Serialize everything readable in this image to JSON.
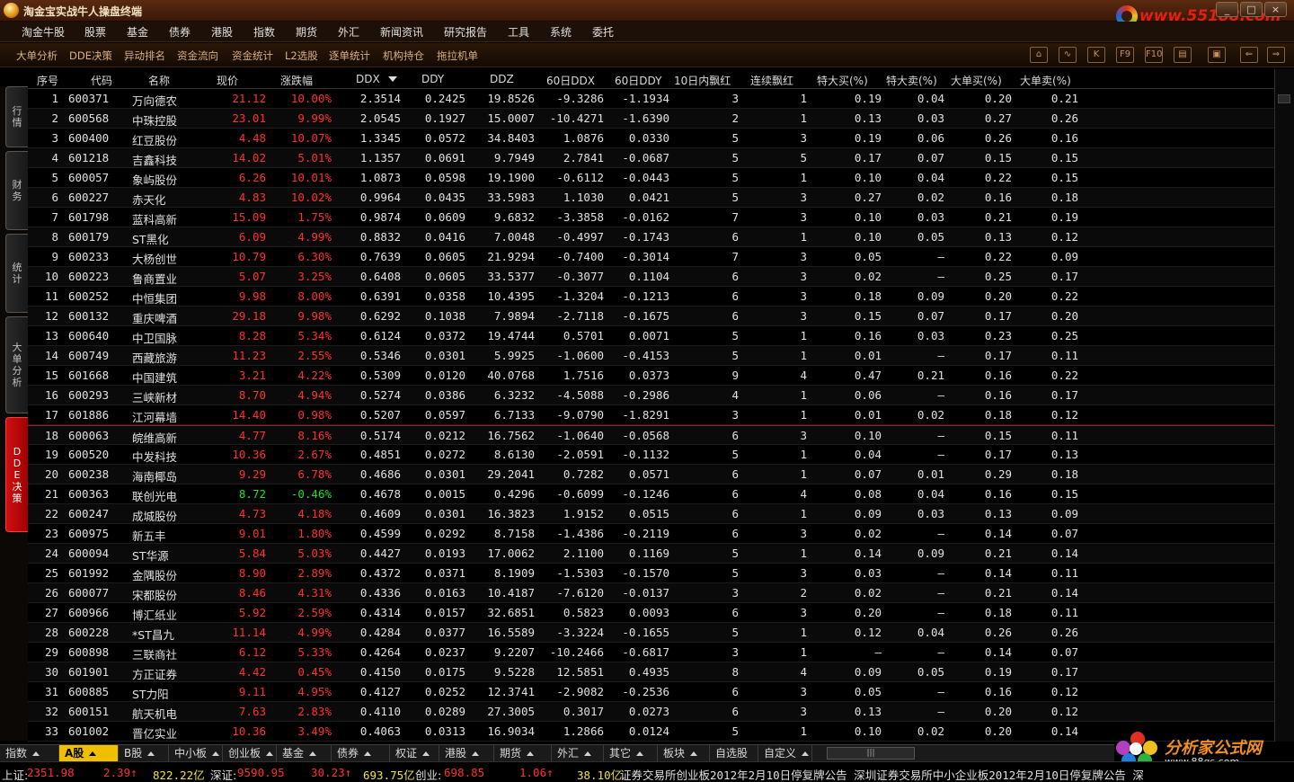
{
  "window": {
    "title": "淘金宝实战牛人操盘终端",
    "site_url": "www.55188.com",
    "controls": [
      "_",
      "□",
      "×"
    ]
  },
  "menu": [
    "淘金牛股",
    "股票",
    "基金",
    "债券",
    "港股",
    "指数",
    "期货",
    "外汇",
    "新闻资讯",
    "研究报告",
    "工具",
    "系统",
    "委托"
  ],
  "toolbar": [
    "大单分析",
    "DDE决策",
    "异动排名",
    "资金流向",
    "资金统计",
    "L2选股",
    "逐单统计",
    "机构持仓",
    "拖拉机单"
  ],
  "toolbar_icons": [
    "home-icon",
    "chart-icon",
    "k-line-icon",
    "f9-icon",
    "f10-icon",
    "layout-icon",
    "window-icon",
    "back-icon",
    "forward-icon"
  ],
  "toolbar_icon_labels": [
    "⌂",
    "∿",
    "K",
    "F9",
    "F10",
    "▤",
    "▣",
    "⇐",
    "⇒"
  ],
  "sidetabs": [
    {
      "label": "行\n情",
      "active": false
    },
    {
      "label": "财\n务",
      "active": false
    },
    {
      "label": "统\n计",
      "active": false
    },
    {
      "label": "大\n单\n分\n析",
      "active": false
    },
    {
      "label": "D\nD\nE\n决\n策",
      "active": true
    }
  ],
  "columns": [
    "序号",
    "代码",
    "名称",
    "现价",
    "涨跌幅",
    "DDX",
    "DDY",
    "DDZ",
    "60日DDX",
    "60日DDY",
    "10日内飘红",
    "连续飘红",
    "特大买(%)",
    "特大卖(%)",
    "大单买(%)",
    "大单卖(%)"
  ],
  "sort_column": "DDX",
  "rows": [
    [
      "1",
      "600371",
      "万向德农",
      "21.12",
      "10.00%",
      "2.3514",
      "0.2425",
      "19.8526",
      "-9.3286",
      "-1.1934",
      "3",
      "1",
      "0.19",
      "0.04",
      "0.20",
      "0.21"
    ],
    [
      "2",
      "600568",
      "中珠控股",
      "23.01",
      "9.99%",
      "2.0545",
      "0.1927",
      "15.0007",
      "-10.4271",
      "-1.6390",
      "2",
      "1",
      "0.13",
      "0.03",
      "0.27",
      "0.26"
    ],
    [
      "3",
      "600400",
      "红豆股份",
      "4.48",
      "10.07%",
      "1.3345",
      "0.0572",
      "34.8403",
      "1.0876",
      "0.0330",
      "5",
      "3",
      "0.19",
      "0.06",
      "0.26",
      "0.16"
    ],
    [
      "4",
      "601218",
      "吉鑫科技",
      "14.02",
      "5.01%",
      "1.1357",
      "0.0691",
      "9.7949",
      "2.7841",
      "-0.0687",
      "5",
      "5",
      "0.17",
      "0.07",
      "0.15",
      "0.15"
    ],
    [
      "5",
      "600057",
      "象屿股份",
      "6.26",
      "10.01%",
      "1.0873",
      "0.0598",
      "19.1900",
      "-0.6112",
      "-0.0443",
      "5",
      "1",
      "0.10",
      "0.04",
      "0.22",
      "0.15"
    ],
    [
      "6",
      "600227",
      "赤天化",
      "4.83",
      "10.02%",
      "0.9964",
      "0.0435",
      "33.5983",
      "1.1030",
      "0.0421",
      "5",
      "3",
      "0.27",
      "0.02",
      "0.16",
      "0.18"
    ],
    [
      "7",
      "601798",
      "蓝科高新",
      "15.09",
      "1.75%",
      "0.9874",
      "0.0609",
      "9.6832",
      "-3.3858",
      "-0.0162",
      "7",
      "3",
      "0.10",
      "0.03",
      "0.21",
      "0.19"
    ],
    [
      "8",
      "600179",
      "ST黑化",
      "6.09",
      "4.99%",
      "0.8832",
      "0.0416",
      "7.0048",
      "-0.4997",
      "-0.1743",
      "6",
      "1",
      "0.10",
      "0.05",
      "0.13",
      "0.12"
    ],
    [
      "9",
      "600233",
      "大杨创世",
      "10.79",
      "6.30%",
      "0.7639",
      "0.0605",
      "21.9294",
      "-0.7400",
      "-0.3014",
      "7",
      "3",
      "0.05",
      "—",
      "0.22",
      "0.09"
    ],
    [
      "10",
      "600223",
      "鲁商置业",
      "5.07",
      "3.25%",
      "0.6408",
      "0.0605",
      "33.5377",
      "-0.3077",
      "0.1104",
      "6",
      "3",
      "0.02",
      "—",
      "0.25",
      "0.17"
    ],
    [
      "11",
      "600252",
      "中恒集团",
      "9.98",
      "8.00%",
      "0.6391",
      "0.0358",
      "10.4395",
      "-1.3204",
      "-0.1213",
      "6",
      "3",
      "0.18",
      "0.09",
      "0.20",
      "0.22"
    ],
    [
      "12",
      "600132",
      "重庆啤酒",
      "29.18",
      "9.98%",
      "0.6292",
      "0.1038",
      "7.9894",
      "-2.7118",
      "-0.1675",
      "6",
      "3",
      "0.15",
      "0.07",
      "0.17",
      "0.20"
    ],
    [
      "13",
      "600640",
      "中卫国脉",
      "8.28",
      "5.34%",
      "0.6124",
      "0.0372",
      "19.4744",
      "0.5701",
      "0.0071",
      "5",
      "1",
      "0.16",
      "0.03",
      "0.23",
      "0.25"
    ],
    [
      "14",
      "600749",
      "西藏旅游",
      "11.23",
      "2.55%",
      "0.5346",
      "0.0301",
      "5.9925",
      "-1.0600",
      "-0.4153",
      "5",
      "1",
      "0.01",
      "—",
      "0.17",
      "0.11"
    ],
    [
      "15",
      "601668",
      "中国建筑",
      "3.21",
      "4.22%",
      "0.5309",
      "0.0120",
      "40.0768",
      "1.7516",
      "0.0373",
      "9",
      "4",
      "0.47",
      "0.21",
      "0.16",
      "0.22"
    ],
    [
      "16",
      "600293",
      "三峡新材",
      "8.70",
      "4.94%",
      "0.5274",
      "0.0386",
      "6.3232",
      "-4.5088",
      "-0.2986",
      "4",
      "1",
      "0.06",
      "—",
      "0.16",
      "0.17"
    ],
    [
      "17",
      "601886",
      "江河幕墙",
      "14.40",
      "0.98%",
      "0.5207",
      "0.0597",
      "6.7133",
      "-9.0790",
      "-1.8291",
      "3",
      "1",
      "0.01",
      "0.02",
      "0.18",
      "0.12"
    ],
    [
      "18",
      "600063",
      "皖维高新",
      "4.77",
      "8.16%",
      "0.5174",
      "0.0212",
      "16.7562",
      "-1.0640",
      "-0.0568",
      "6",
      "3",
      "0.10",
      "—",
      "0.15",
      "0.11"
    ],
    [
      "19",
      "600520",
      "中发科技",
      "10.36",
      "2.67%",
      "0.4851",
      "0.0272",
      "8.6130",
      "-2.0591",
      "-0.1132",
      "5",
      "1",
      "0.04",
      "—",
      "0.17",
      "0.13"
    ],
    [
      "20",
      "600238",
      "海南椰岛",
      "9.29",
      "6.78%",
      "0.4686",
      "0.0301",
      "29.2041",
      "0.7282",
      "0.0571",
      "6",
      "1",
      "0.07",
      "0.01",
      "0.29",
      "0.18"
    ],
    [
      "21",
      "600363",
      "联创光电",
      "8.72",
      "-0.46%",
      "0.4678",
      "0.0015",
      "0.4296",
      "-0.6099",
      "-0.1246",
      "6",
      "4",
      "0.08",
      "0.04",
      "0.16",
      "0.15"
    ],
    [
      "22",
      "600247",
      "成城股份",
      "4.73",
      "4.18%",
      "0.4609",
      "0.0301",
      "16.3823",
      "1.9152",
      "0.0515",
      "6",
      "1",
      "0.09",
      "0.03",
      "0.13",
      "0.09"
    ],
    [
      "23",
      "600975",
      "新五丰",
      "9.01",
      "1.80%",
      "0.4599",
      "0.0292",
      "8.7158",
      "-1.4386",
      "-0.2119",
      "6",
      "3",
      "0.02",
      "—",
      "0.14",
      "0.07"
    ],
    [
      "24",
      "600094",
      "ST华源",
      "5.84",
      "5.03%",
      "0.4427",
      "0.0193",
      "17.0062",
      "2.1100",
      "0.1169",
      "5",
      "1",
      "0.14",
      "0.09",
      "0.21",
      "0.14"
    ],
    [
      "25",
      "601992",
      "金隅股份",
      "8.90",
      "2.89%",
      "0.4372",
      "0.0371",
      "8.1909",
      "-1.5303",
      "-0.1570",
      "5",
      "3",
      "0.03",
      "—",
      "0.14",
      "0.11"
    ],
    [
      "26",
      "600077",
      "宋都股份",
      "8.46",
      "4.31%",
      "0.4336",
      "0.0163",
      "10.4187",
      "-7.6120",
      "-0.0137",
      "3",
      "2",
      "0.02",
      "—",
      "0.21",
      "0.14"
    ],
    [
      "27",
      "600966",
      "博汇纸业",
      "5.92",
      "2.59%",
      "0.4314",
      "0.0157",
      "32.6851",
      "0.5823",
      "0.0093",
      "6",
      "3",
      "0.20",
      "—",
      "0.18",
      "0.11"
    ],
    [
      "28",
      "600228",
      "*ST昌九",
      "11.14",
      "4.99%",
      "0.4284",
      "0.0377",
      "16.5589",
      "-3.3224",
      "-0.1655",
      "5",
      "1",
      "0.12",
      "0.04",
      "0.26",
      "0.26"
    ],
    [
      "29",
      "600898",
      "三联商社",
      "6.12",
      "5.33%",
      "0.4264",
      "0.0237",
      "9.2207",
      "-10.2466",
      "-0.6817",
      "3",
      "1",
      "—",
      "—",
      "0.14",
      "0.07"
    ],
    [
      "30",
      "601901",
      "方正证券",
      "4.42",
      "0.45%",
      "0.4150",
      "0.0175",
      "9.5228",
      "12.5851",
      "0.4935",
      "8",
      "4",
      "0.09",
      "0.05",
      "0.19",
      "0.17"
    ],
    [
      "31",
      "600885",
      "ST力阳",
      "9.11",
      "4.95%",
      "0.4127",
      "0.0252",
      "12.3741",
      "-2.9082",
      "-0.2536",
      "6",
      "3",
      "0.05",
      "—",
      "0.16",
      "0.12"
    ],
    [
      "32",
      "600151",
      "航天机电",
      "7.63",
      "2.83%",
      "0.4110",
      "0.0289",
      "27.3005",
      "0.3017",
      "0.0273",
      "6",
      "3",
      "0.13",
      "—",
      "0.20",
      "0.12"
    ],
    [
      "33",
      "601002",
      "晋亿实业",
      "10.36",
      "3.49%",
      "0.4063",
      "0.0313",
      "16.9034",
      "1.2866",
      "0.0124",
      "5",
      "1",
      "0.10",
      "0.02",
      "0.20",
      "0.14"
    ]
  ],
  "bottom_tabs": [
    "指数",
    "A股",
    "B股",
    "中小板",
    "创业板",
    "基金",
    "债券",
    "权证",
    "港股",
    "期货",
    "外汇",
    "其它",
    "板块",
    "自选股",
    "自定义"
  ],
  "active_bottom_tab": "A股",
  "hscroll_label": "|||",
  "brand": {
    "name": "分析家公式网",
    "url": "www.88gs.com"
  },
  "status": {
    "sh_label": "上证:",
    "sh_value": "2351.98",
    "sh_change": "2.39↑",
    "sh_amount": "822.22亿",
    "sz_label": "深证:",
    "sz_value": "9590.95",
    "sz_change": "30.23↑",
    "sz_amount": "693.75亿",
    "cy_label": "创业:",
    "cy_value": "698.85",
    "cy_change": "1.06↑",
    "cy_amount": "38.10亿",
    "ticker": "证券交易所创业板2012年2月10日停复牌公告  深圳证券交易所中小企业板2012年2月10日停复牌公告  深"
  },
  "colors": {
    "up": "#ff3030",
    "down": "#20e020",
    "accent": "#f0c000",
    "active_side": "#d01010"
  }
}
